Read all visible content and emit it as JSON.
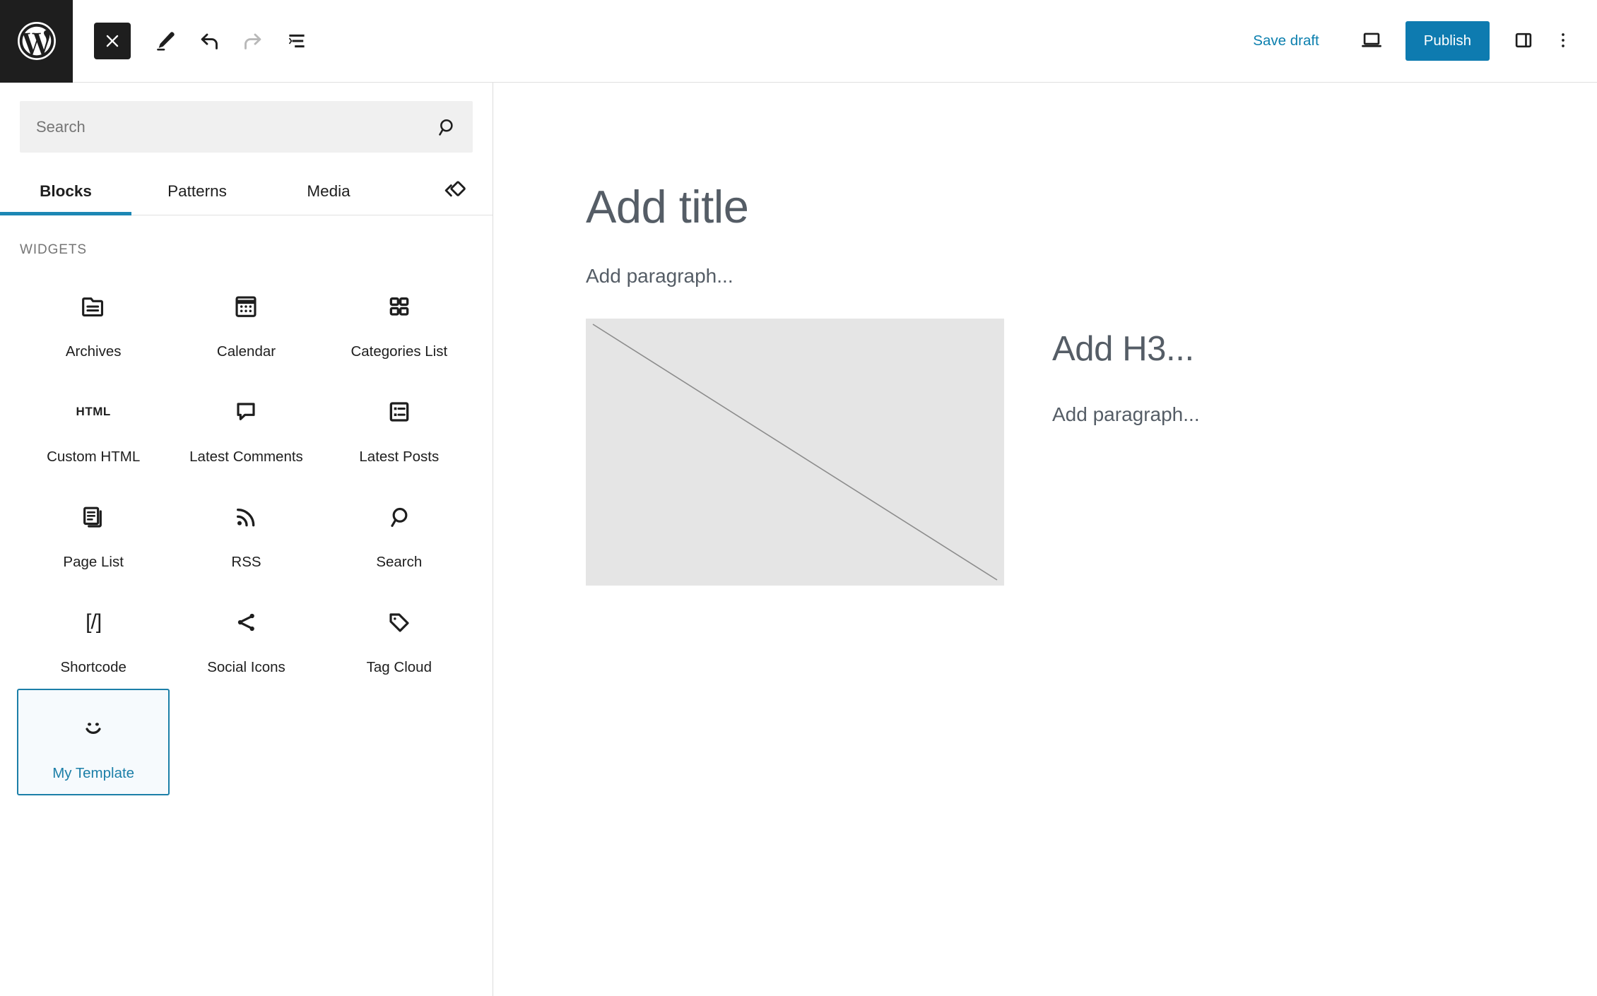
{
  "header": {
    "logo_icon": "wordpress-logo-icon",
    "close_button": {
      "icon": "close-icon",
      "label": "Close"
    },
    "tools": [
      {
        "name": "edit-tool",
        "icon": "pencil-icon",
        "label": "Edit",
        "disabled": false
      },
      {
        "name": "undo",
        "icon": "undo-icon",
        "label": "Undo",
        "disabled": false
      },
      {
        "name": "redo",
        "icon": "redo-icon",
        "label": "Redo",
        "disabled": true
      },
      {
        "name": "list-view",
        "icon": "list-view-icon",
        "label": "List View",
        "disabled": false
      }
    ],
    "save_draft_label": "Save draft",
    "preview_icon": "laptop-preview-icon",
    "publish_label": "Publish",
    "sidebar_toggle_icon": "sidebar-panel-icon",
    "options_icon": "three-dots-vertical-icon",
    "accent_color": "#0e7bb0",
    "link_color": "#0b7fae"
  },
  "sidebar": {
    "search": {
      "value": "",
      "placeholder": "Search",
      "icon": "search-icon"
    },
    "tabs": [
      {
        "label": "Blocks",
        "active": true
      },
      {
        "label": "Patterns",
        "active": false
      },
      {
        "label": "Media",
        "active": false
      }
    ],
    "tab_indicator_color": "#1c87b4",
    "code_view_icon": "block-diamonds-icon",
    "section_label": "Widgets",
    "blocks": [
      {
        "label": "Archives",
        "icon": "archives-folder-icon",
        "selected": false
      },
      {
        "label": "Calendar",
        "icon": "calendar-icon",
        "selected": false
      },
      {
        "label": "Categories List",
        "icon": "grid-squares-icon",
        "selected": false
      },
      {
        "label": "Custom HTML",
        "icon": "html-text-icon",
        "selected": false
      },
      {
        "label": "Latest Comments",
        "icon": "comment-bubble-icon",
        "selected": false
      },
      {
        "label": "Latest Posts",
        "icon": "list-document-icon",
        "selected": false
      },
      {
        "label": "Page List",
        "icon": "pages-stack-icon",
        "selected": false
      },
      {
        "label": "RSS",
        "icon": "rss-icon",
        "selected": false
      },
      {
        "label": "Search",
        "icon": "search-magnifier-icon",
        "selected": false
      },
      {
        "label": "Shortcode",
        "icon": "shortcode-brackets-icon",
        "selected": false
      },
      {
        "label": "Social Icons",
        "icon": "share-nodes-icon",
        "selected": false
      },
      {
        "label": "Tag Cloud",
        "icon": "tag-icon",
        "selected": false
      },
      {
        "label": "My Template",
        "icon": "smiley-face-icon",
        "selected": true
      }
    ],
    "selected_block_border_color": "#1c7fa8",
    "selected_block_bg_color": "#f6fafd",
    "html_glyph": "HTML",
    "shortcode_glyph": "[/]"
  },
  "canvas": {
    "title_placeholder": "Add title",
    "paragraph_placeholder_top": "Add paragraph...",
    "heading_placeholder": "Add H3...",
    "paragraph_placeholder_side": "Add paragraph...",
    "media_placeholder_icon": "image-diagonal-placeholder",
    "media_placeholder_bg": "#e5e5e5"
  }
}
